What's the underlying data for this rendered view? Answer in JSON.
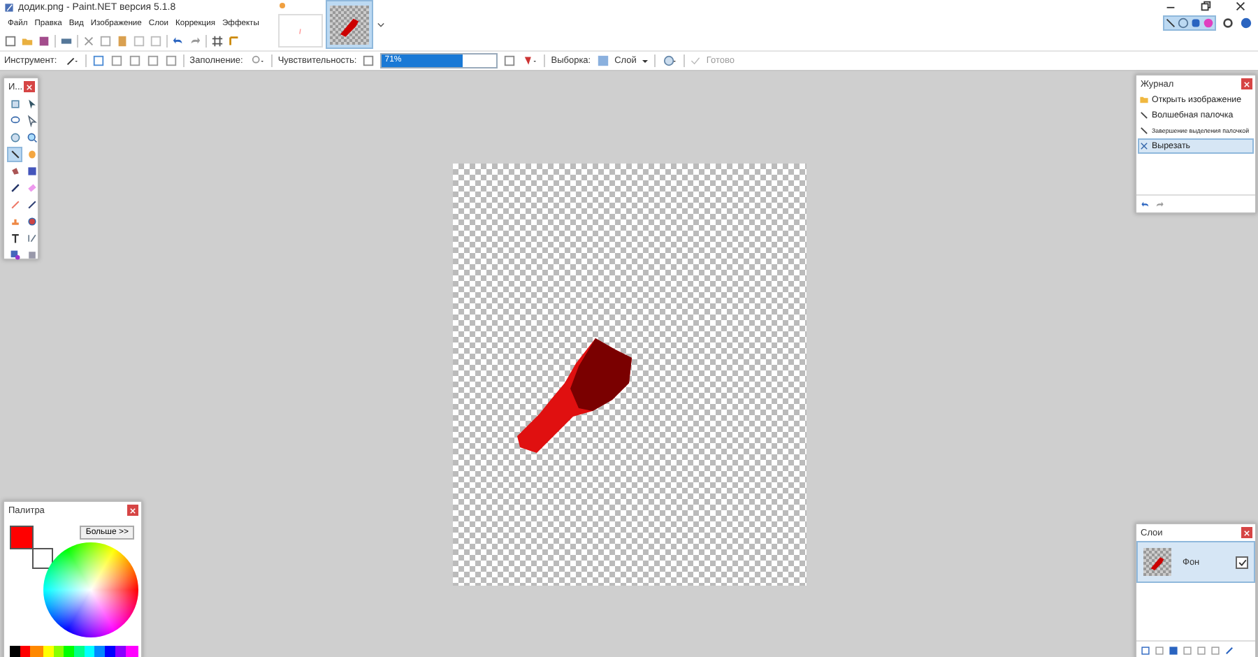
{
  "window": {
    "title": "додик.png - Paint.NET версия 5.1.8"
  },
  "menu": [
    "Файл",
    "Правка",
    "Вид",
    "Изображение",
    "Слои",
    "Коррекция",
    "Эффекты"
  ],
  "image_tabs": [
    {
      "selected": false,
      "unsaved": true
    },
    {
      "selected": true,
      "unsaved": false
    }
  ],
  "tool_options": {
    "tool_label": "Инструмент:",
    "fill_label": "Заполнение:",
    "sensitivity_label": "Чувствительность:",
    "sensitivity": {
      "reading": "71%",
      "level": 0.71
    },
    "sampling_label": "Выборка:",
    "sampling_value": "Слой",
    "done": {
      "label": "Готово",
      "disabled": true
    }
  },
  "tools": {
    "title": "И...",
    "items": [
      {
        "selected": false
      },
      {
        "selected": false
      },
      {
        "selected": false
      },
      {
        "selected": false
      },
      {
        "selected": false
      },
      {
        "selected": false
      },
      {
        "selected": true
      },
      {
        "selected": false
      },
      {
        "selected": false
      },
      {
        "selected": false
      },
      {
        "selected": false
      },
      {
        "selected": false
      },
      {
        "selected": false
      },
      {
        "selected": false
      },
      {
        "selected": false
      },
      {
        "selected": false
      },
      {
        "selected": false
      },
      {
        "selected": false
      },
      {
        "selected": false
      },
      {
        "selected": false
      }
    ]
  },
  "history": {
    "title": "Журнал",
    "items": [
      {
        "label": "Открыть изображение",
        "kind": "open",
        "selected": false
      },
      {
        "label": "Волшебная палочка",
        "kind": "wand",
        "selected": false
      },
      {
        "label": "Завершение выделения палочкой",
        "kind": "wand",
        "selected": false
      },
      {
        "label": "Вырезать",
        "kind": "cut",
        "selected": true
      }
    ]
  },
  "palette": {
    "title": "Палитра",
    "more_button": "Больше >>"
  },
  "layers": {
    "title": "Слои",
    "items": [
      {
        "name": "Фон",
        "visible": true,
        "selected": true
      }
    ]
  }
}
